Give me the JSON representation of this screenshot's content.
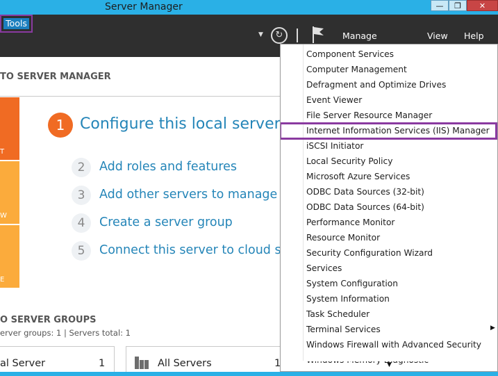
{
  "window": {
    "title": "Server Manager",
    "min_glyph": "—",
    "max_glyph": "❐",
    "close_glyph": "✕"
  },
  "menubar": {
    "manage": "Manage",
    "tools": "Tools",
    "view": "View",
    "help": "Help"
  },
  "icons": {
    "refresh": "refresh-icon",
    "flag": "flag-icon",
    "dropdown": "chevron-down-icon"
  },
  "welcome": {
    "title": "TO SERVER MANAGER"
  },
  "tiles": [
    "T",
    "W",
    "E"
  ],
  "steps": [
    {
      "num": "1",
      "text": "Configure this local server"
    },
    {
      "num": "2",
      "text": "Add roles and features"
    },
    {
      "num": "3",
      "text": "Add other servers to manage"
    },
    {
      "num": "4",
      "text": "Create a server group"
    },
    {
      "num": "5",
      "text": "Connect this server to cloud servi"
    }
  ],
  "server_groups": {
    "title": "O SERVER GROUPS",
    "summary": "erver groups: 1   |   Servers total: 1",
    "cards": [
      {
        "label": "al Server",
        "count": "1"
      },
      {
        "label": "All Servers",
        "count": "1"
      }
    ]
  },
  "tools_menu": {
    "items": [
      "Component Services",
      "Computer Management",
      "Defragment and Optimize Drives",
      "Event Viewer",
      "File Server Resource Manager",
      "Internet Information Services (IIS) Manager",
      "iSCSI Initiator",
      "Local Security Policy",
      "Microsoft Azure Services",
      "ODBC Data Sources (32-bit)",
      "ODBC Data Sources (64-bit)",
      "Performance Monitor",
      "Resource Monitor",
      "Security Configuration Wizard",
      "Services",
      "System Configuration",
      "System Information",
      "Task Scheduler",
      "Terminal Services",
      "Windows Firewall with Advanced Security",
      "Windows Memory Diagnostic"
    ],
    "highlighted": "Internet Information Services (IIS) Manager",
    "submenu_arrow": "▶",
    "scroll_arrow": "▼"
  },
  "colors": {
    "accent": "#2ab0e6",
    "highlight": "#8a3aa0",
    "link": "#2485b8",
    "orange": "#f06b23"
  }
}
